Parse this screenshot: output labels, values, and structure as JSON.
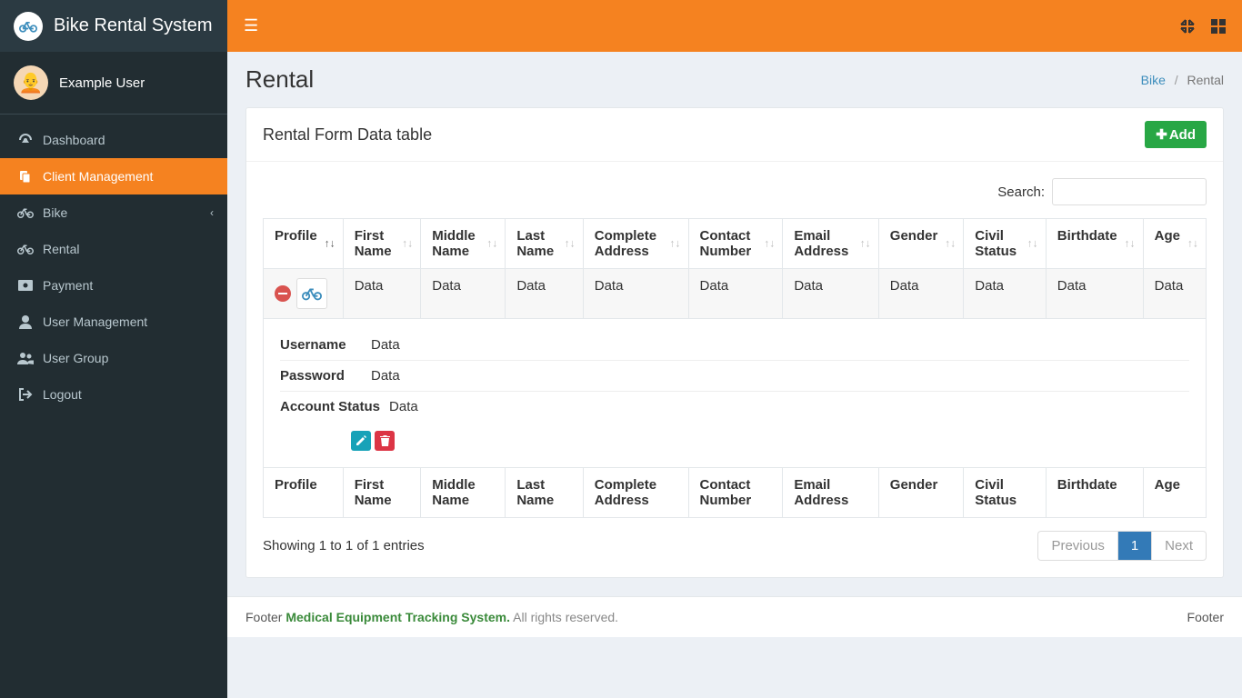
{
  "app": {
    "title": "Bike Rental System"
  },
  "user": {
    "name": "Example User"
  },
  "sidebar": {
    "items": [
      {
        "label": "Dashboard",
        "icon": "dashboard-icon",
        "active": false
      },
      {
        "label": "Client Management",
        "icon": "files-icon",
        "active": true
      },
      {
        "label": "Bike",
        "icon": "bike-icon",
        "active": false,
        "expandable": true
      },
      {
        "label": "Rental",
        "icon": "bike-icon",
        "active": false
      },
      {
        "label": "Payment",
        "icon": "payment-icon",
        "active": false
      },
      {
        "label": "User Management",
        "icon": "user-icon",
        "active": false
      },
      {
        "label": "User Group",
        "icon": "users-icon",
        "active": false
      },
      {
        "label": "Logout",
        "icon": "logout-icon",
        "active": false
      }
    ]
  },
  "page": {
    "title": "Rental",
    "breadcrumb": {
      "link": "Bike",
      "current": "Rental"
    }
  },
  "panel": {
    "title": "Rental Form Data table",
    "add_label": "Add",
    "search_label": "Search:",
    "search_value": ""
  },
  "table": {
    "headers": [
      "Profile",
      "First Name",
      "Middle Name",
      "Last Name",
      "Complete Address",
      "Contact Number",
      "Email Address",
      "Gender",
      "Civil Status",
      "Birthdate",
      "Age"
    ],
    "rows": [
      {
        "cells": [
          "",
          "Data",
          "Data",
          "Data",
          "Data",
          "Data",
          "Data",
          "Data",
          "Data",
          "Data",
          "Data"
        ],
        "details": [
          {
            "label": "Username",
            "value": "Data"
          },
          {
            "label": "Password",
            "value": "Data"
          },
          {
            "label": "Account Status",
            "value": "Data"
          }
        ]
      }
    ],
    "footers": [
      "Profile",
      "First Name",
      "Middle Name",
      "Last Name",
      "Complete Address",
      "Contact Number",
      "Email Address",
      "Gender",
      "Civil Status",
      "Birthdate",
      "Age"
    ],
    "info": "Showing 1 to 1 of 1 entries",
    "pagination": {
      "prev": "Previous",
      "pages": [
        "1"
      ],
      "next": "Next"
    }
  },
  "footer": {
    "left_prefix": "Footer ",
    "system": "Medical Equipment Tracking System.",
    "rights": " All rights reserved.",
    "right": "Footer"
  }
}
